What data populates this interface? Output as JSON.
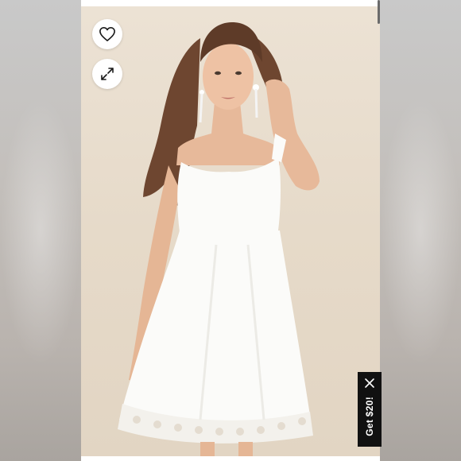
{
  "product_image": {
    "subject": "white-eyelet-mini-dress",
    "background_color": "#e6dac9",
    "dress_color": "#fbfbf9"
  },
  "actions": {
    "favorite_icon": "heart-icon",
    "expand_icon": "expand-icon"
  },
  "promo": {
    "label": "Get $20!",
    "close_icon": "close-icon",
    "background": "#111111",
    "text_color": "#ffffff"
  }
}
